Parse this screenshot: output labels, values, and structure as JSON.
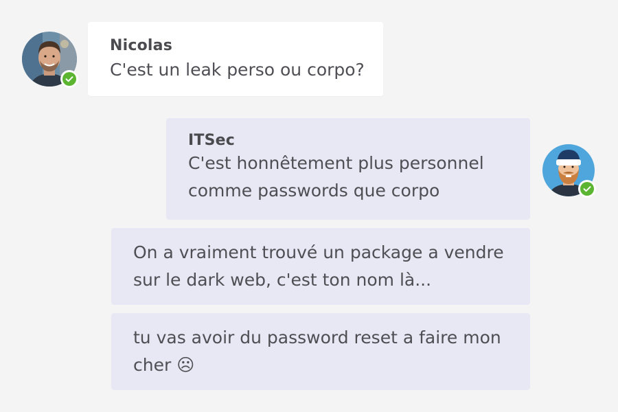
{
  "messages": [
    {
      "sender": "Nicolas",
      "text": "C'est un leak perso ou corpo?",
      "avatar": "nicolas-photo-avatar",
      "status": "available"
    },
    {
      "sender": "ITSec",
      "lines": [
        "C'est honnêtement plus personnel",
        "comme passwords que corpo"
      ],
      "avatar": "bearded-hat-avatar",
      "status": "available"
    },
    {
      "lines": [
        "On a vraiment trouvé un package a vendre",
        "sur le dark web, c'est ton nom là..."
      ]
    },
    {
      "lines": [
        "tu vas avoir du password reset a faire mon",
        "cher ☹"
      ]
    }
  ],
  "colors": {
    "background": "#f4f4f4",
    "incoming_bubble": "#ffffff",
    "outgoing_bubble": "#e8e8f4",
    "status_available": "#5cb531"
  }
}
